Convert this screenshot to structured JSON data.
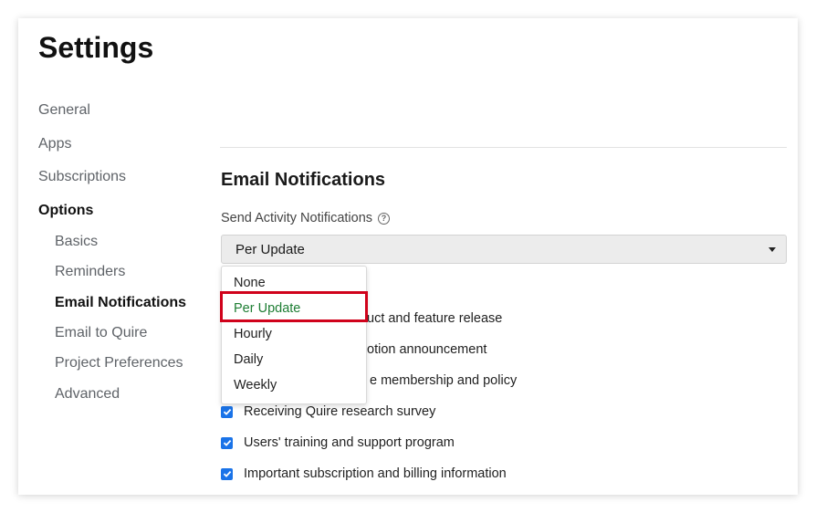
{
  "page": {
    "title": "Settings"
  },
  "nav": {
    "items": [
      {
        "label": "General"
      },
      {
        "label": "Apps"
      },
      {
        "label": "Subscriptions"
      },
      {
        "label": "Options"
      }
    ],
    "sub_items": [
      {
        "label": "Basics"
      },
      {
        "label": "Reminders"
      },
      {
        "label": "Email Notifications"
      },
      {
        "label": "Email to Quire"
      },
      {
        "label": "Project Preferences"
      },
      {
        "label": "Advanced"
      }
    ]
  },
  "section": {
    "title": "Email Notifications",
    "field_label": "Send Activity Notifications",
    "select_value": "Per Update",
    "dropdown_options": [
      "None",
      "Per Update",
      "Hourly",
      "Daily",
      "Weekly"
    ],
    "selected_option": "Per Update"
  },
  "checkboxes": [
    {
      "label": "Product and feature release",
      "visible_text": "uct and feature release",
      "checked": true
    },
    {
      "label": "Promotion announcement",
      "visible_text": "otion announcement",
      "checked": true
    },
    {
      "label": "Changes to the membership and policy",
      "visible_text": "e membership and policy",
      "checked": true
    },
    {
      "label": "Receiving Quire research survey",
      "visible_text": "Receiving Quire research survey",
      "checked": true
    },
    {
      "label": "Users' training and support program",
      "visible_text": "Users' training and support program",
      "checked": true
    },
    {
      "label": "Important subscription and billing information",
      "visible_text": "Important subscription and billing information",
      "checked": true
    }
  ],
  "colors": {
    "accent_checkbox": "#1a73e8",
    "selected_option": "#1e7e34",
    "highlight_border": "#d0021b"
  }
}
